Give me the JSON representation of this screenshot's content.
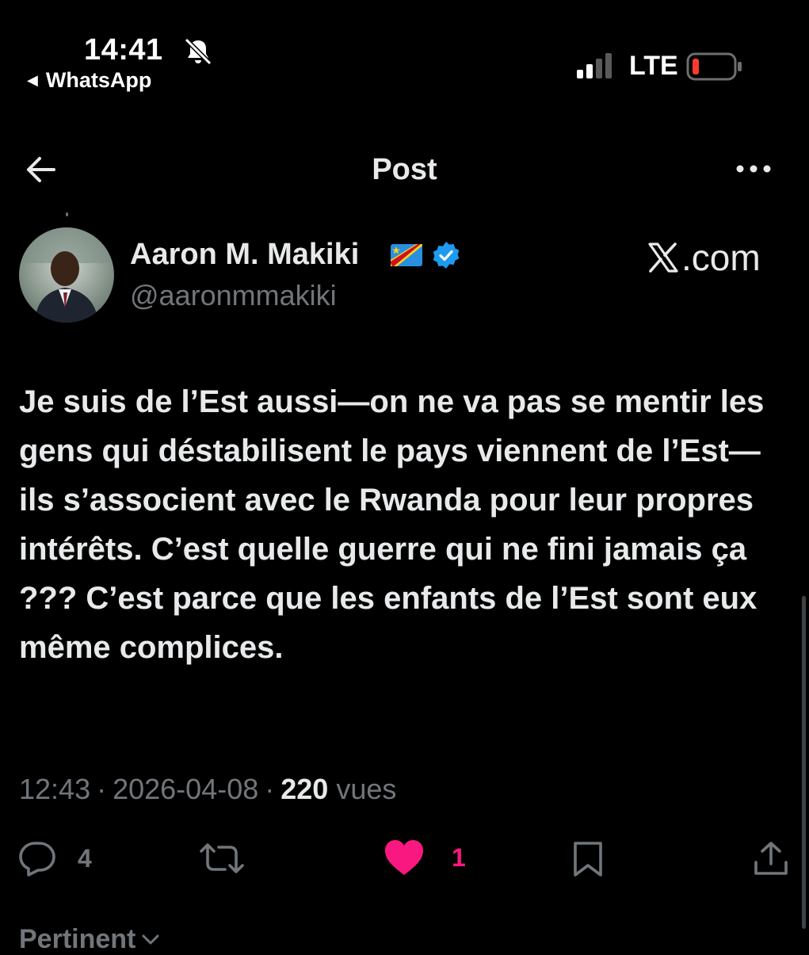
{
  "status_bar": {
    "time": "14:41",
    "back_app": "WhatsApp",
    "network": "LTE",
    "battery_color": "#ff3b30"
  },
  "nav": {
    "title": "Post"
  },
  "author": {
    "name": "Aaron M. Makiki",
    "handle": "@aaronmmakiki",
    "verified_color": "#1d9bf0"
  },
  "source_label": ".com",
  "tweet": {
    "text": "Je suis de l’Est aussi—on ne va pas se mentir les gens qui déstabilisent le pays viennent de l’Est—ils s’associent avec le Rwanda pour leur propres intérêts. C’est quelle guerre qui ne fini jamais ça ??? C’est parce que les enfants de l’Est sont eux même complices."
  },
  "meta": {
    "time": "12:43",
    "separator": "·",
    "date": "2026-04-08",
    "views": "220",
    "views_label": "vues"
  },
  "actions": {
    "reply_count": "4",
    "like_count": "1",
    "like_color": "#f91880"
  },
  "sort_label": "Pertinent",
  "icons": [
    "bell-slash-icon",
    "back-triangle-icon",
    "signal-icon",
    "battery-icon",
    "back-arrow-icon",
    "more-icon",
    "flag-icon",
    "verified-icon",
    "x-logo-icon",
    "reply-icon",
    "repost-icon",
    "heart-icon",
    "bookmark-icon",
    "share-icon",
    "chevron-down-icon"
  ]
}
